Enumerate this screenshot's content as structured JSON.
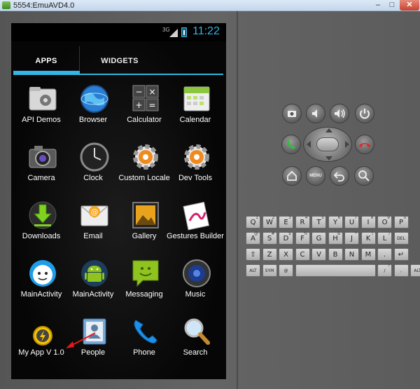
{
  "window": {
    "title": "5554:EmuAVD4.0",
    "min": "–",
    "max": "□",
    "close": "✕"
  },
  "status_bar": {
    "network": "3G",
    "time": "11:22"
  },
  "tabs": [
    {
      "label": "APPS"
    },
    {
      "label": "WIDGETS"
    }
  ],
  "apps": [
    {
      "label": "API Demos",
      "icon": "folder-gear-icon"
    },
    {
      "label": "Browser",
      "icon": "globe-icon"
    },
    {
      "label": "Calculator",
      "icon": "calculator-icon"
    },
    {
      "label": "Calendar",
      "icon": "calendar-icon"
    },
    {
      "label": "Camera",
      "icon": "camera-icon"
    },
    {
      "label": "Clock",
      "icon": "clock-icon"
    },
    {
      "label": "Custom Locale",
      "icon": "gear-icon"
    },
    {
      "label": "Dev Tools",
      "icon": "gear-icon"
    },
    {
      "label": "Downloads",
      "icon": "download-icon"
    },
    {
      "label": "Email",
      "icon": "email-icon"
    },
    {
      "label": "Gallery",
      "icon": "gallery-icon"
    },
    {
      "label": "Gestures Builder",
      "icon": "gestures-icon"
    },
    {
      "label": "MainActivity",
      "icon": "face-icon"
    },
    {
      "label": "MainActivity",
      "icon": "android-icon"
    },
    {
      "label": "Messaging",
      "icon": "message-icon"
    },
    {
      "label": "Music",
      "icon": "speaker-icon"
    },
    {
      "label": "My App V 1.0",
      "icon": "lightning-icon"
    },
    {
      "label": "People",
      "icon": "contacts-icon"
    },
    {
      "label": "Phone",
      "icon": "phone-icon"
    },
    {
      "label": "Search",
      "icon": "search-icon"
    }
  ],
  "controls": {
    "menu": "MENU"
  },
  "keyboard": {
    "row1": [
      {
        "k": "Q",
        "s": "1"
      },
      {
        "k": "W",
        "s": "2"
      },
      {
        "k": "E",
        "s": "3"
      },
      {
        "k": "R",
        "s": "4"
      },
      {
        "k": "T",
        "s": "5"
      },
      {
        "k": "Y",
        "s": "6"
      },
      {
        "k": "U",
        "s": "7"
      },
      {
        "k": "I",
        "s": "8"
      },
      {
        "k": "O",
        "s": "9"
      },
      {
        "k": "P",
        "s": "0"
      }
    ],
    "row2": [
      {
        "k": "A",
        "s": "@"
      },
      {
        "k": "S",
        "s": "#"
      },
      {
        "k": "D",
        "s": "$"
      },
      {
        "k": "F",
        "s": "%"
      },
      {
        "k": "G",
        "s": "^"
      },
      {
        "k": "H",
        "s": "&"
      },
      {
        "k": "J",
        "s": "*"
      },
      {
        "k": "K",
        "s": "("
      },
      {
        "k": "L",
        "s": ")"
      },
      {
        "k": "DEL",
        "s": ""
      }
    ],
    "row3": [
      {
        "k": "⇧",
        "s": ""
      },
      {
        "k": "Z",
        "s": ""
      },
      {
        "k": "X",
        "s": ""
      },
      {
        "k": "C",
        "s": ""
      },
      {
        "k": "V",
        "s": ""
      },
      {
        "k": "B",
        "s": ""
      },
      {
        "k": "N",
        "s": ""
      },
      {
        "k": "M",
        "s": ""
      },
      {
        "k": ".",
        "s": ""
      },
      {
        "k": "↵",
        "s": ""
      }
    ],
    "row4": [
      {
        "k": "ALT",
        "s": ""
      },
      {
        "k": "SYM",
        "s": ""
      },
      {
        "k": "@",
        "s": ""
      },
      {
        "k": "",
        "s": ""
      },
      {
        "k": "/",
        "s": "?"
      },
      {
        "k": ",",
        "s": ""
      },
      {
        "k": "ALT",
        "s": ""
      }
    ]
  },
  "colors": {
    "accent": "#33b5e5",
    "screen_bg": "#000000",
    "skin": "#5a5a5a"
  }
}
